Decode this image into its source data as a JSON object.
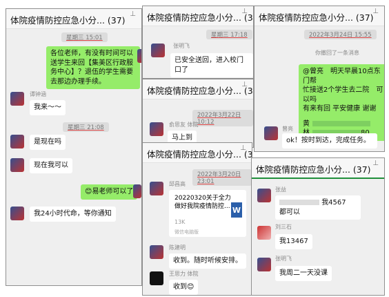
{
  "panels": [
    {
      "title": "体院疫情防控应急小分... (37)"
    },
    {
      "title": "体院疫情防控应急小分... (37)"
    },
    {
      "title": "体院疫情防控应急小分... (37)"
    },
    {
      "title": "体院疫情防控应急小分... (37)"
    },
    {
      "title": "体院疫情防控应急小分... (37)"
    },
    {
      "title": "体院疫情防控应急小分... (37)"
    }
  ],
  "p1": {
    "time1": "星期三 15:01",
    "msg1": "各位老师，有没有时间可以送学生来回【集美区行政服务中心】？退伍的学生需要去那边办理手续。",
    "nick1": "谭钟涵",
    "msg2": "我来～～",
    "time2": "星期三 21:08",
    "msg3": "是现在吗",
    "msg4": "现在我可以",
    "msg5": "易老师可以了",
    "msg6": "我24小时代命，等你通知"
  },
  "p2": {
    "time": "星期三 17:18",
    "nick": "张明飞",
    "msg": "已安全送回，进入校门口了"
  },
  "p3": {
    "time": "2022年3月24日 15:55",
    "system": "你撤回了一条消息",
    "msg_lines": [
      "@曾亮　明天早晨10点东门帮",
      "忙接送2个学生去二院　可以吗",
      "有来有回 平安健康 谢谢"
    ],
    "line_phone1": "黄",
    "line_phone2": "林",
    "line_phone2_tail": "80",
    "nick": "曾亮",
    "msg": "ok！按时到达，完成任务。"
  },
  "p4": {
    "time": "2022年3月22日 10:12",
    "nick": "俞思友 体院",
    "msg": "马上到"
  },
  "p5": {
    "time": "2022年3月20日 23:01",
    "nick1": "邱昌高",
    "file_title": "20220320关于全力做好我院疫情防控...",
    "file_size": "13K",
    "file_src": "微信电脑版",
    "nick2": "陈建明",
    "msg2": "收到。随时听候安排。",
    "nick3": "王思力 体院",
    "msg3": "收到"
  },
  "p6": {
    "nick1": "张益",
    "msg1a": "我4567",
    "msg1b": "都可以",
    "nick2": "刘三石",
    "msg2": "我13467",
    "nick3": "张明飞",
    "msg3": "我周二一天没课"
  }
}
